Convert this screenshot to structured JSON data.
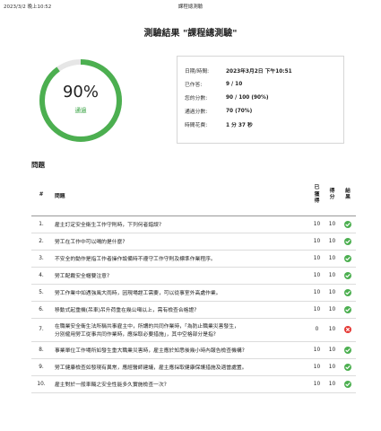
{
  "print_header": {
    "timestamp": "2023/3/2 晚上10:52",
    "doc_title": "課程總測驗"
  },
  "title": "測驗結果 \"課程總測驗\"",
  "score_ring": {
    "percent_label": "90%",
    "percent": 90,
    "status": "通過",
    "color": "#4caf50",
    "track_color": "#e6e6e6"
  },
  "summary": [
    {
      "label": "日期/時間:",
      "value": "2023年3月2日 下午10:51"
    },
    {
      "label": "已作答:",
      "value": "9 / 10"
    },
    {
      "label": "您的分數:",
      "value": "90 / 100 (90%)"
    },
    {
      "label": "通過分數:",
      "value": "70 (70%)"
    },
    {
      "label": "時間花費:",
      "value": "1 分 37 秒"
    }
  ],
  "questions_section": {
    "heading": "問題",
    "columns": {
      "num": "#",
      "question": "問題",
      "earned": "已獲得",
      "points": "得分",
      "result": "結果"
    },
    "rows": [
      {
        "num": "1.",
        "question": "雇主訂定安全衛生工作守則時，下列何者錯誤?",
        "earned": "10",
        "points": "10",
        "result": "correct"
      },
      {
        "num": "2.",
        "question": "勞工在工作中可以喝的是什麼?",
        "earned": "10",
        "points": "10",
        "result": "correct"
      },
      {
        "num": "3.",
        "question": "不安全的動作是指工作者操作設備時不遵守工作守則及標準作業程序。",
        "earned": "10",
        "points": "10",
        "result": "correct"
      },
      {
        "num": "4.",
        "question": "勞工配戴安全帽要注意?",
        "earned": "10",
        "points": "10",
        "result": "correct"
      },
      {
        "num": "5.",
        "question": "勞工作業中如遇強風大雨時，因現場趕工需要，可以從事室外高處作業。",
        "earned": "10",
        "points": "10",
        "result": "correct"
      },
      {
        "num": "6.",
        "question": "移動式起重機(吊車)吊升荷重在幾公噸以上，需有檢查合格證?",
        "earned": "10",
        "points": "10",
        "result": "correct"
      },
      {
        "num": "7.",
        "question_lines": [
          "在職業安全衛生法所稱共事雇主中，所謂的共同作業時，「為防止職業災害發生，",
          "分別僱用勞工從事共同作業時，應採取必要措施」，其中空格部分是指?"
        ],
        "question": "在職業安全衛生法所稱共事雇主中，所謂的共同作業時，「為防止職業災害發生，分別僱用勞工從事共同作業時，應採取必要措施」，其中空格部分是指?",
        "earned": "0",
        "points": "10",
        "result": "wrong"
      },
      {
        "num": "8.",
        "question": "事業單位工作場所如發生重大職業災害時，雇主應於知悉後幾小時內報告檢查機構?",
        "earned": "10",
        "points": "10",
        "result": "correct"
      },
      {
        "num": "9.",
        "question": "勞工健康檢查如發現有異常，應經醫師建議，雇主應採取健康保護措施及適當處置。",
        "earned": "10",
        "points": "10",
        "result": "correct"
      },
      {
        "num": "10.",
        "question": "雇主對於一般車輛之安全性能多久實施檢查一次?",
        "earned": "10",
        "points": "10",
        "result": "correct"
      }
    ]
  }
}
